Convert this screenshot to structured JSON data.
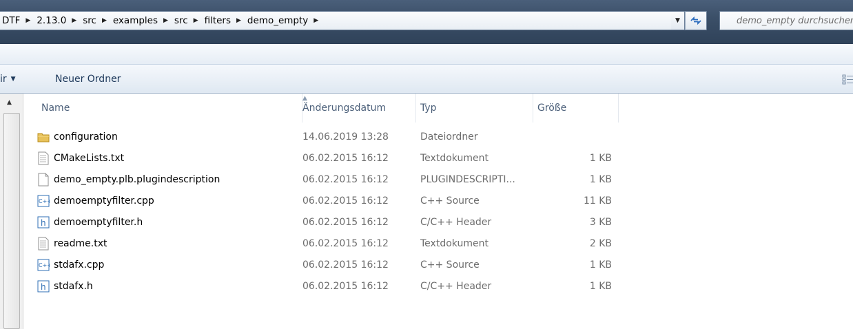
{
  "address": {
    "crumbs": [
      "DTF",
      "2.13.0",
      "src",
      "examples",
      "src",
      "filters",
      "demo_empty"
    ],
    "search_placeholder": "demo_empty durchsuchen"
  },
  "commands": {
    "organize_label": "ir",
    "new_folder_label": "Neuer Ordner"
  },
  "columns": {
    "name": "Name",
    "date": "Änderungsdatum",
    "type": "Typ",
    "size": "Größe"
  },
  "files": [
    {
      "name": "configuration",
      "date": "14.06.2019 13:28",
      "type": "Dateiordner",
      "size": "",
      "icon": "folder-icon"
    },
    {
      "name": "CMakeLists.txt",
      "date": "06.02.2015 16:12",
      "type": "Textdokument",
      "size": "1 KB",
      "icon": "text-file-icon"
    },
    {
      "name": "demo_empty.plb.plugindescription",
      "date": "06.02.2015 16:12",
      "type": "PLUGINDESCRIPTI...",
      "size": "1 KB",
      "icon": "generic-file-icon"
    },
    {
      "name": "demoemptyfilter.cpp",
      "date": "06.02.2015 16:12",
      "type": "C++ Source",
      "size": "11 KB",
      "icon": "cpp-file-icon"
    },
    {
      "name": "demoemptyfilter.h",
      "date": "06.02.2015 16:12",
      "type": "C/C++ Header",
      "size": "3 KB",
      "icon": "header-file-icon"
    },
    {
      "name": "readme.txt",
      "date": "06.02.2015 16:12",
      "type": "Textdokument",
      "size": "2 KB",
      "icon": "text-file-icon"
    },
    {
      "name": "stdafx.cpp",
      "date": "06.02.2015 16:12",
      "type": "C++ Source",
      "size": "1 KB",
      "icon": "cpp-file-icon"
    },
    {
      "name": "stdafx.h",
      "date": "06.02.2015 16:12",
      "type": "C/C++ Header",
      "size": "1 KB",
      "icon": "header-file-icon"
    }
  ]
}
